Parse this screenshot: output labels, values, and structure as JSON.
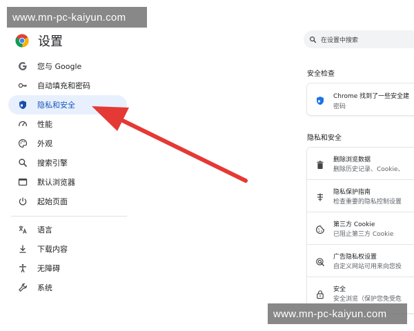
{
  "watermark": {
    "text": "www.mn-pc-kaiyun.com"
  },
  "header": {
    "title": "设置"
  },
  "sidebar": {
    "items": [
      {
        "label": "您与 Google",
        "icon": "google-icon"
      },
      {
        "label": "自动填充和密码",
        "icon": "key-icon"
      },
      {
        "label": "隐私和安全",
        "icon": "shield-icon",
        "active": true
      },
      {
        "label": "性能",
        "icon": "speedometer-icon"
      },
      {
        "label": "外观",
        "icon": "palette-icon"
      },
      {
        "label": "搜索引擎",
        "icon": "search-icon"
      },
      {
        "label": "默认浏览器",
        "icon": "browser-window-icon"
      },
      {
        "label": "起始页面",
        "icon": "power-icon"
      },
      {
        "label": "语言",
        "icon": "translate-icon"
      },
      {
        "label": "下载内容",
        "icon": "download-icon"
      },
      {
        "label": "无障碍",
        "icon": "accessibility-icon"
      },
      {
        "label": "系统",
        "icon": "wrench-icon"
      }
    ]
  },
  "search": {
    "placeholder": "在设置中搜索"
  },
  "safety_check": {
    "title": "安全检查",
    "card_title": "Chrome 找到了一些安全建",
    "card_sub": "密码"
  },
  "privacy": {
    "title": "隐私和安全",
    "rows": [
      {
        "title": "删除浏览数据",
        "sub": "删除历史记录、Cookie、",
        "icon": "trash-icon"
      },
      {
        "title": "隐私保护指南",
        "sub": "检查重要的隐私控制设置",
        "icon": "privacy-guide-icon"
      },
      {
        "title": "第三方 Cookie",
        "sub": "已阻止第三方 Cookie",
        "icon": "cookie-icon"
      },
      {
        "title": "广告隐私权设置",
        "sub": "自定义网站可用来向您投",
        "icon": "ad-privacy-icon"
      },
      {
        "title": "安全",
        "sub": "安全浏览（保护您免受危",
        "icon": "lock-icon"
      }
    ]
  },
  "colors": {
    "accent": "#1a73e8",
    "active_bg": "#e8f0fe",
    "arrow": "#e53935",
    "watermark_bg": "#6e6e6e"
  }
}
